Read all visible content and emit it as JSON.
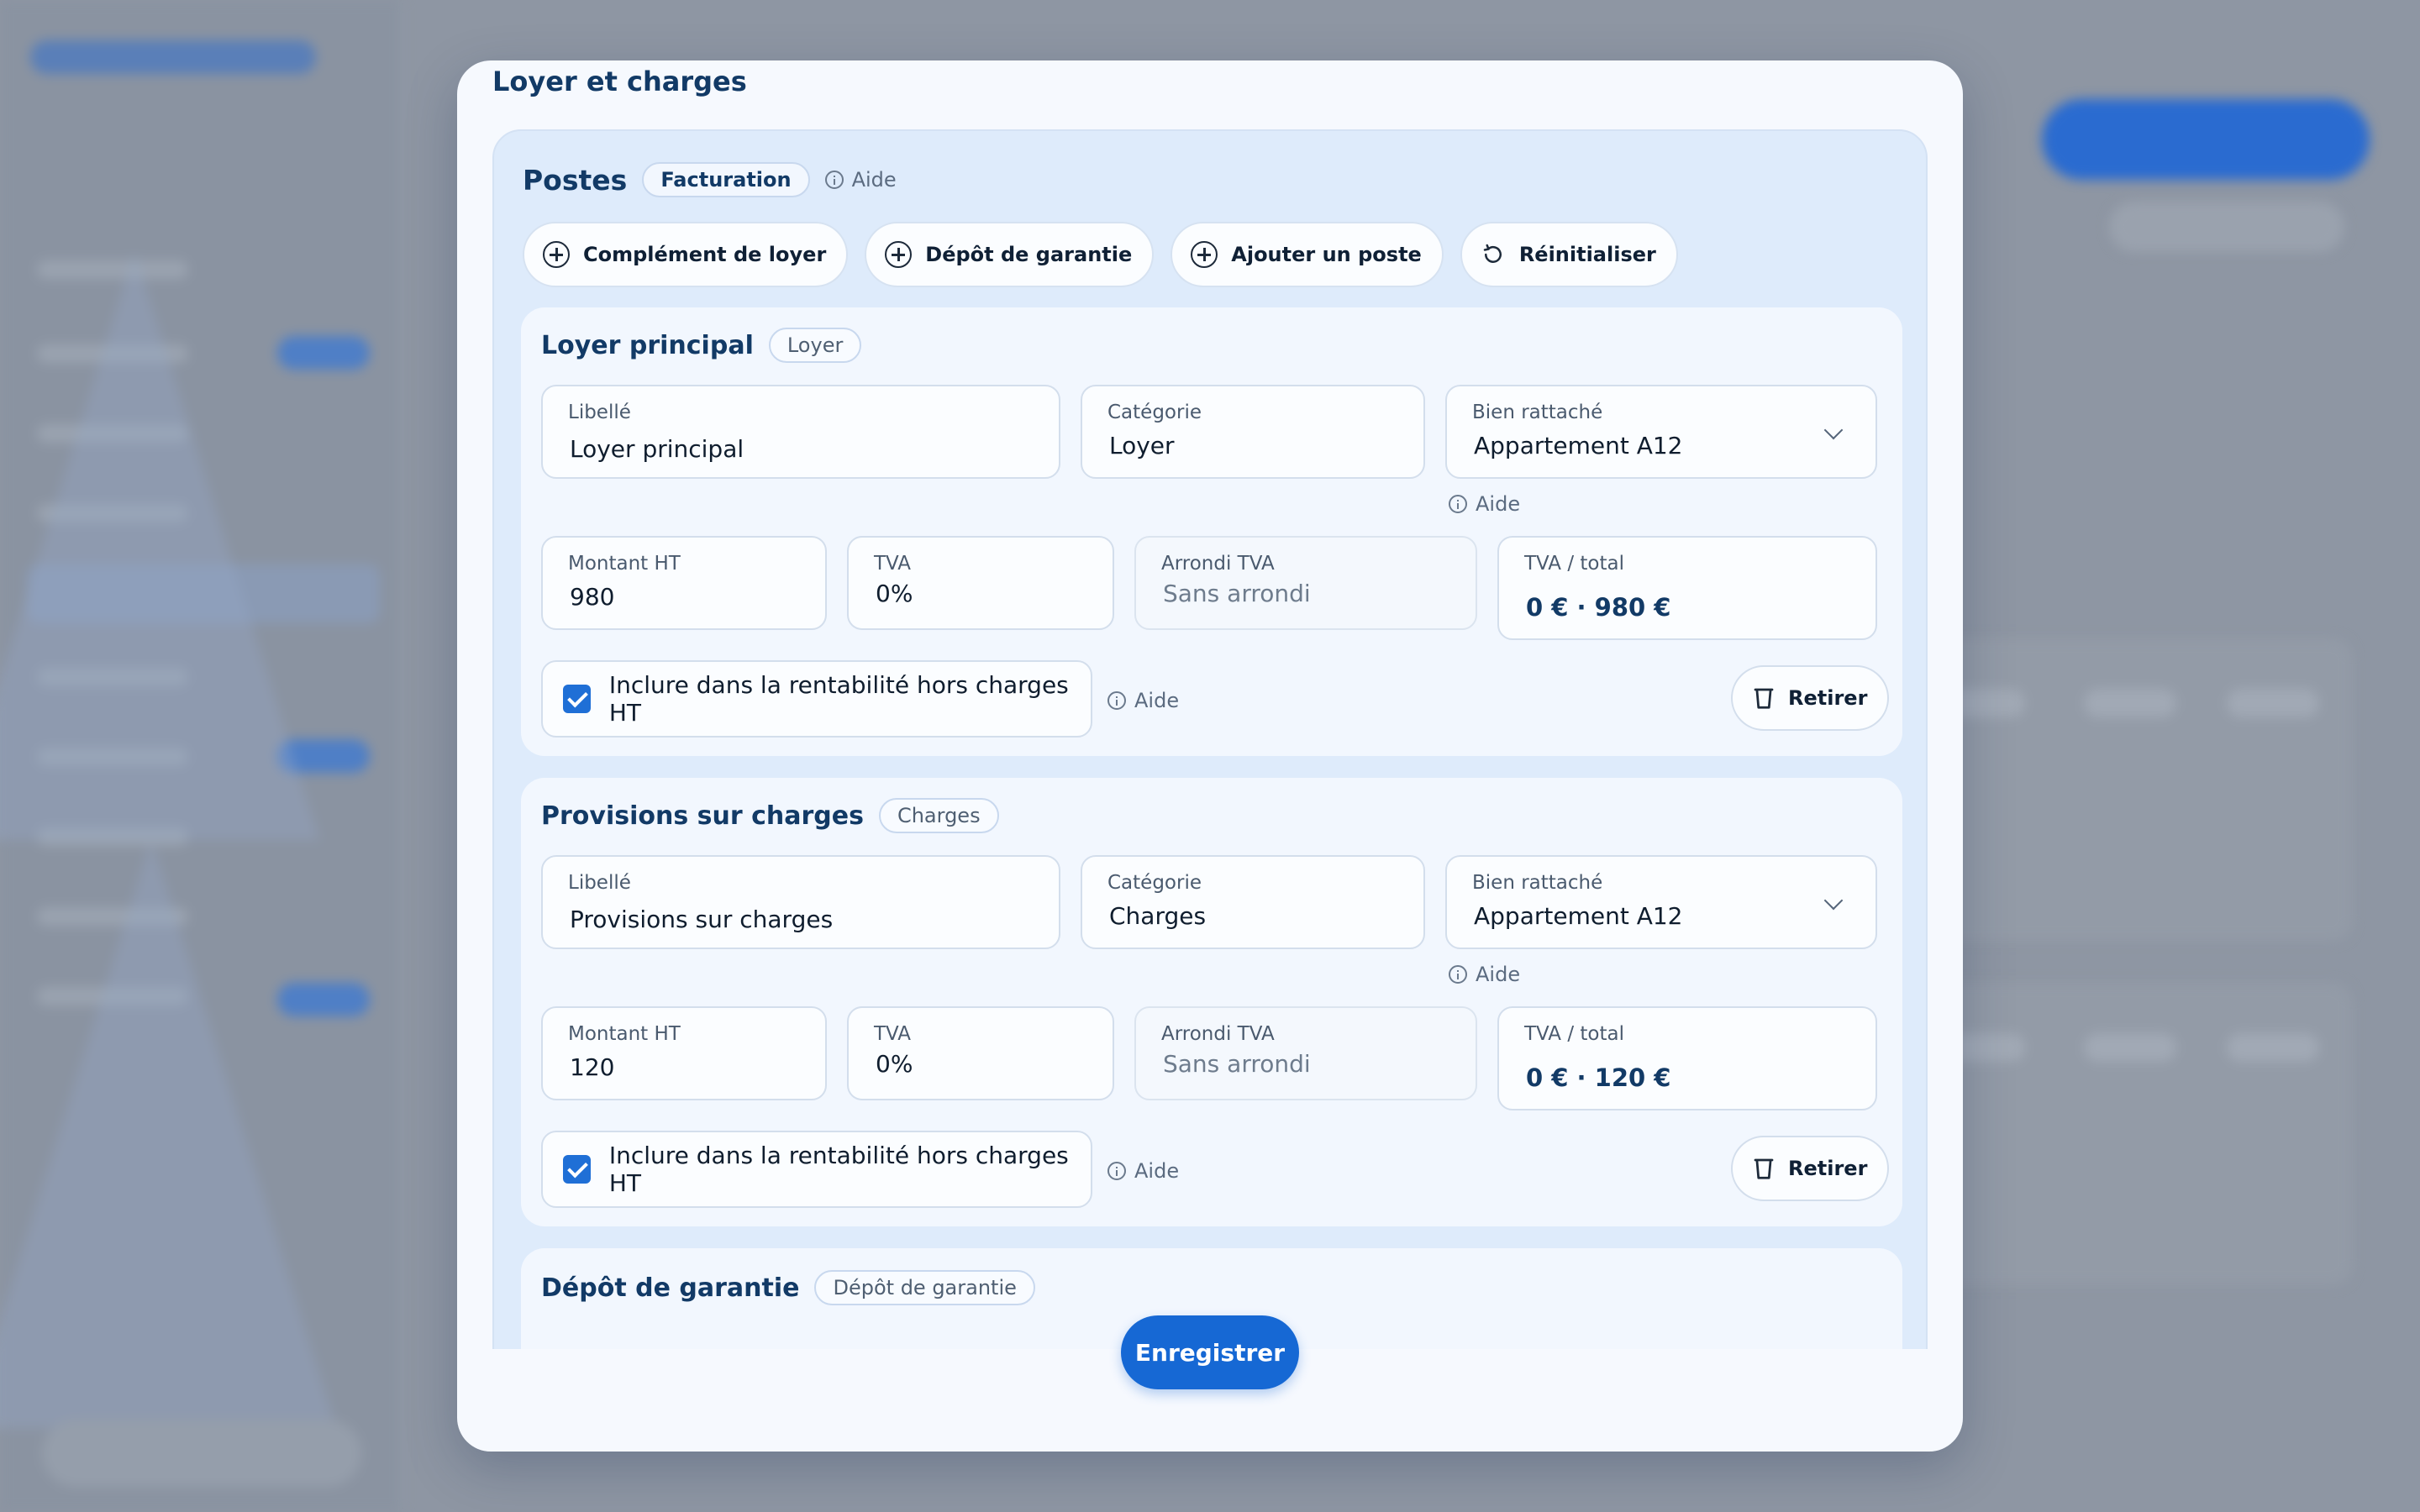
{
  "modal": {
    "title": "Loyer et charges",
    "save_label": "Enregistrer"
  },
  "panel": {
    "title": "Postes",
    "tag": "Facturation",
    "help": "Aide",
    "actions": [
      {
        "label": "Complément de loyer",
        "icon": "plus-circle-icon"
      },
      {
        "label": "Dépôt de garantie",
        "icon": "plus-circle-icon"
      },
      {
        "label": "Ajouter un poste",
        "icon": "plus-circle-icon"
      },
      {
        "label": "Réinitialiser",
        "icon": "reset-icon"
      }
    ]
  },
  "items": [
    {
      "title": "Loyer principal",
      "tag": "Loyer",
      "libelle_label": "Libellé",
      "libelle_value": "Loyer principal",
      "categorie_label": "Catégorie",
      "categorie_value": "Loyer",
      "bien_label": "Bien rattaché",
      "bien_value": "Appartement A12",
      "bien_help": "Aide",
      "montant_label": "Montant HT",
      "montant_value": "980",
      "tva_label": "TVA",
      "tva_value": "0%",
      "arrondi_label": "Arrondi TVA",
      "arrondi_value": "Sans arrondi",
      "total_label": "TVA / total",
      "total_value": "0 € · 980 €",
      "include_label": "Inclure dans la rentabilité hors charges HT",
      "include_checked": true,
      "include_help": "Aide",
      "remove_label": "Retirer"
    },
    {
      "title": "Provisions sur charges",
      "tag": "Charges",
      "libelle_label": "Libellé",
      "libelle_value": "Provisions sur charges",
      "categorie_label": "Catégorie",
      "categorie_value": "Charges",
      "bien_label": "Bien rattaché",
      "bien_value": "Appartement A12",
      "bien_help": "Aide",
      "montant_label": "Montant HT",
      "montant_value": "120",
      "tva_label": "TVA",
      "tva_value": "0%",
      "arrondi_label": "Arrondi TVA",
      "arrondi_value": "Sans arrondi",
      "total_label": "TVA / total",
      "total_value": "0 € · 120 €",
      "include_label": "Inclure dans la rentabilité hors charges HT",
      "include_checked": true,
      "include_help": "Aide",
      "remove_label": "Retirer"
    },
    {
      "title": "Dépôt de garantie",
      "tag": "Dépôt de garantie"
    }
  ],
  "colors": {
    "accent": "#1668d4",
    "title": "#123a66",
    "panel": "#deebfb"
  }
}
